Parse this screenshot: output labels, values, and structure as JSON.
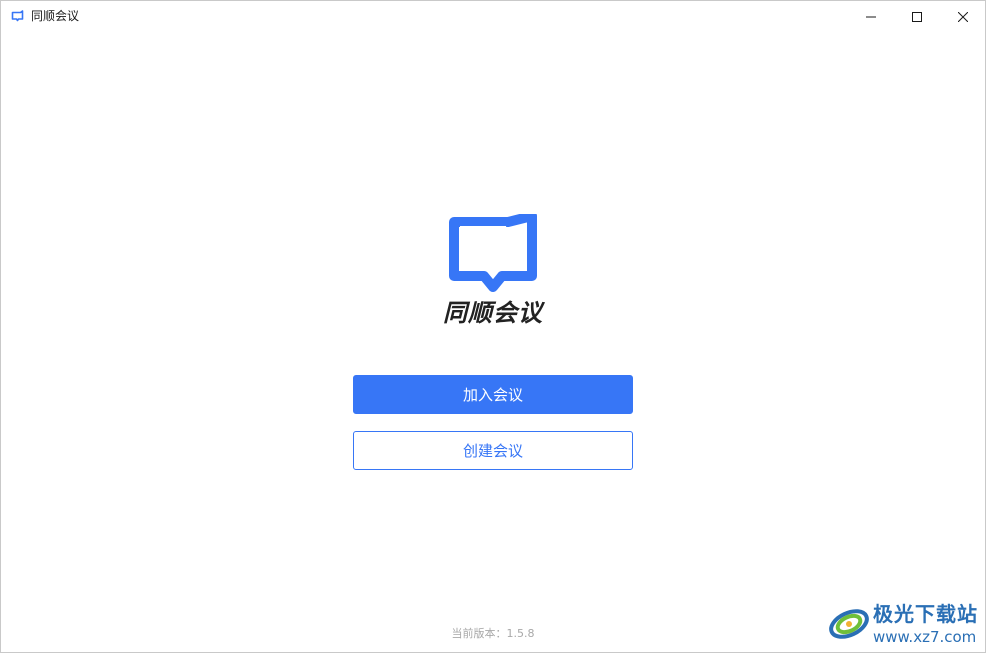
{
  "window": {
    "title": "同顺会议",
    "controls": {
      "minimize_icon": "minimize-icon",
      "maximize_icon": "maximize-icon",
      "close_icon": "close-icon"
    }
  },
  "brand": {
    "name": "同顺会议",
    "logo_icon": "video-chat-bubble-icon",
    "primary_color": "#3776f6"
  },
  "actions": {
    "join_label": "加入会议",
    "create_label": "创建会议"
  },
  "footer": {
    "version_text": "当前版本：1.5.8"
  },
  "watermark": {
    "title": "极光下载站",
    "url": "www.xz7.com"
  }
}
